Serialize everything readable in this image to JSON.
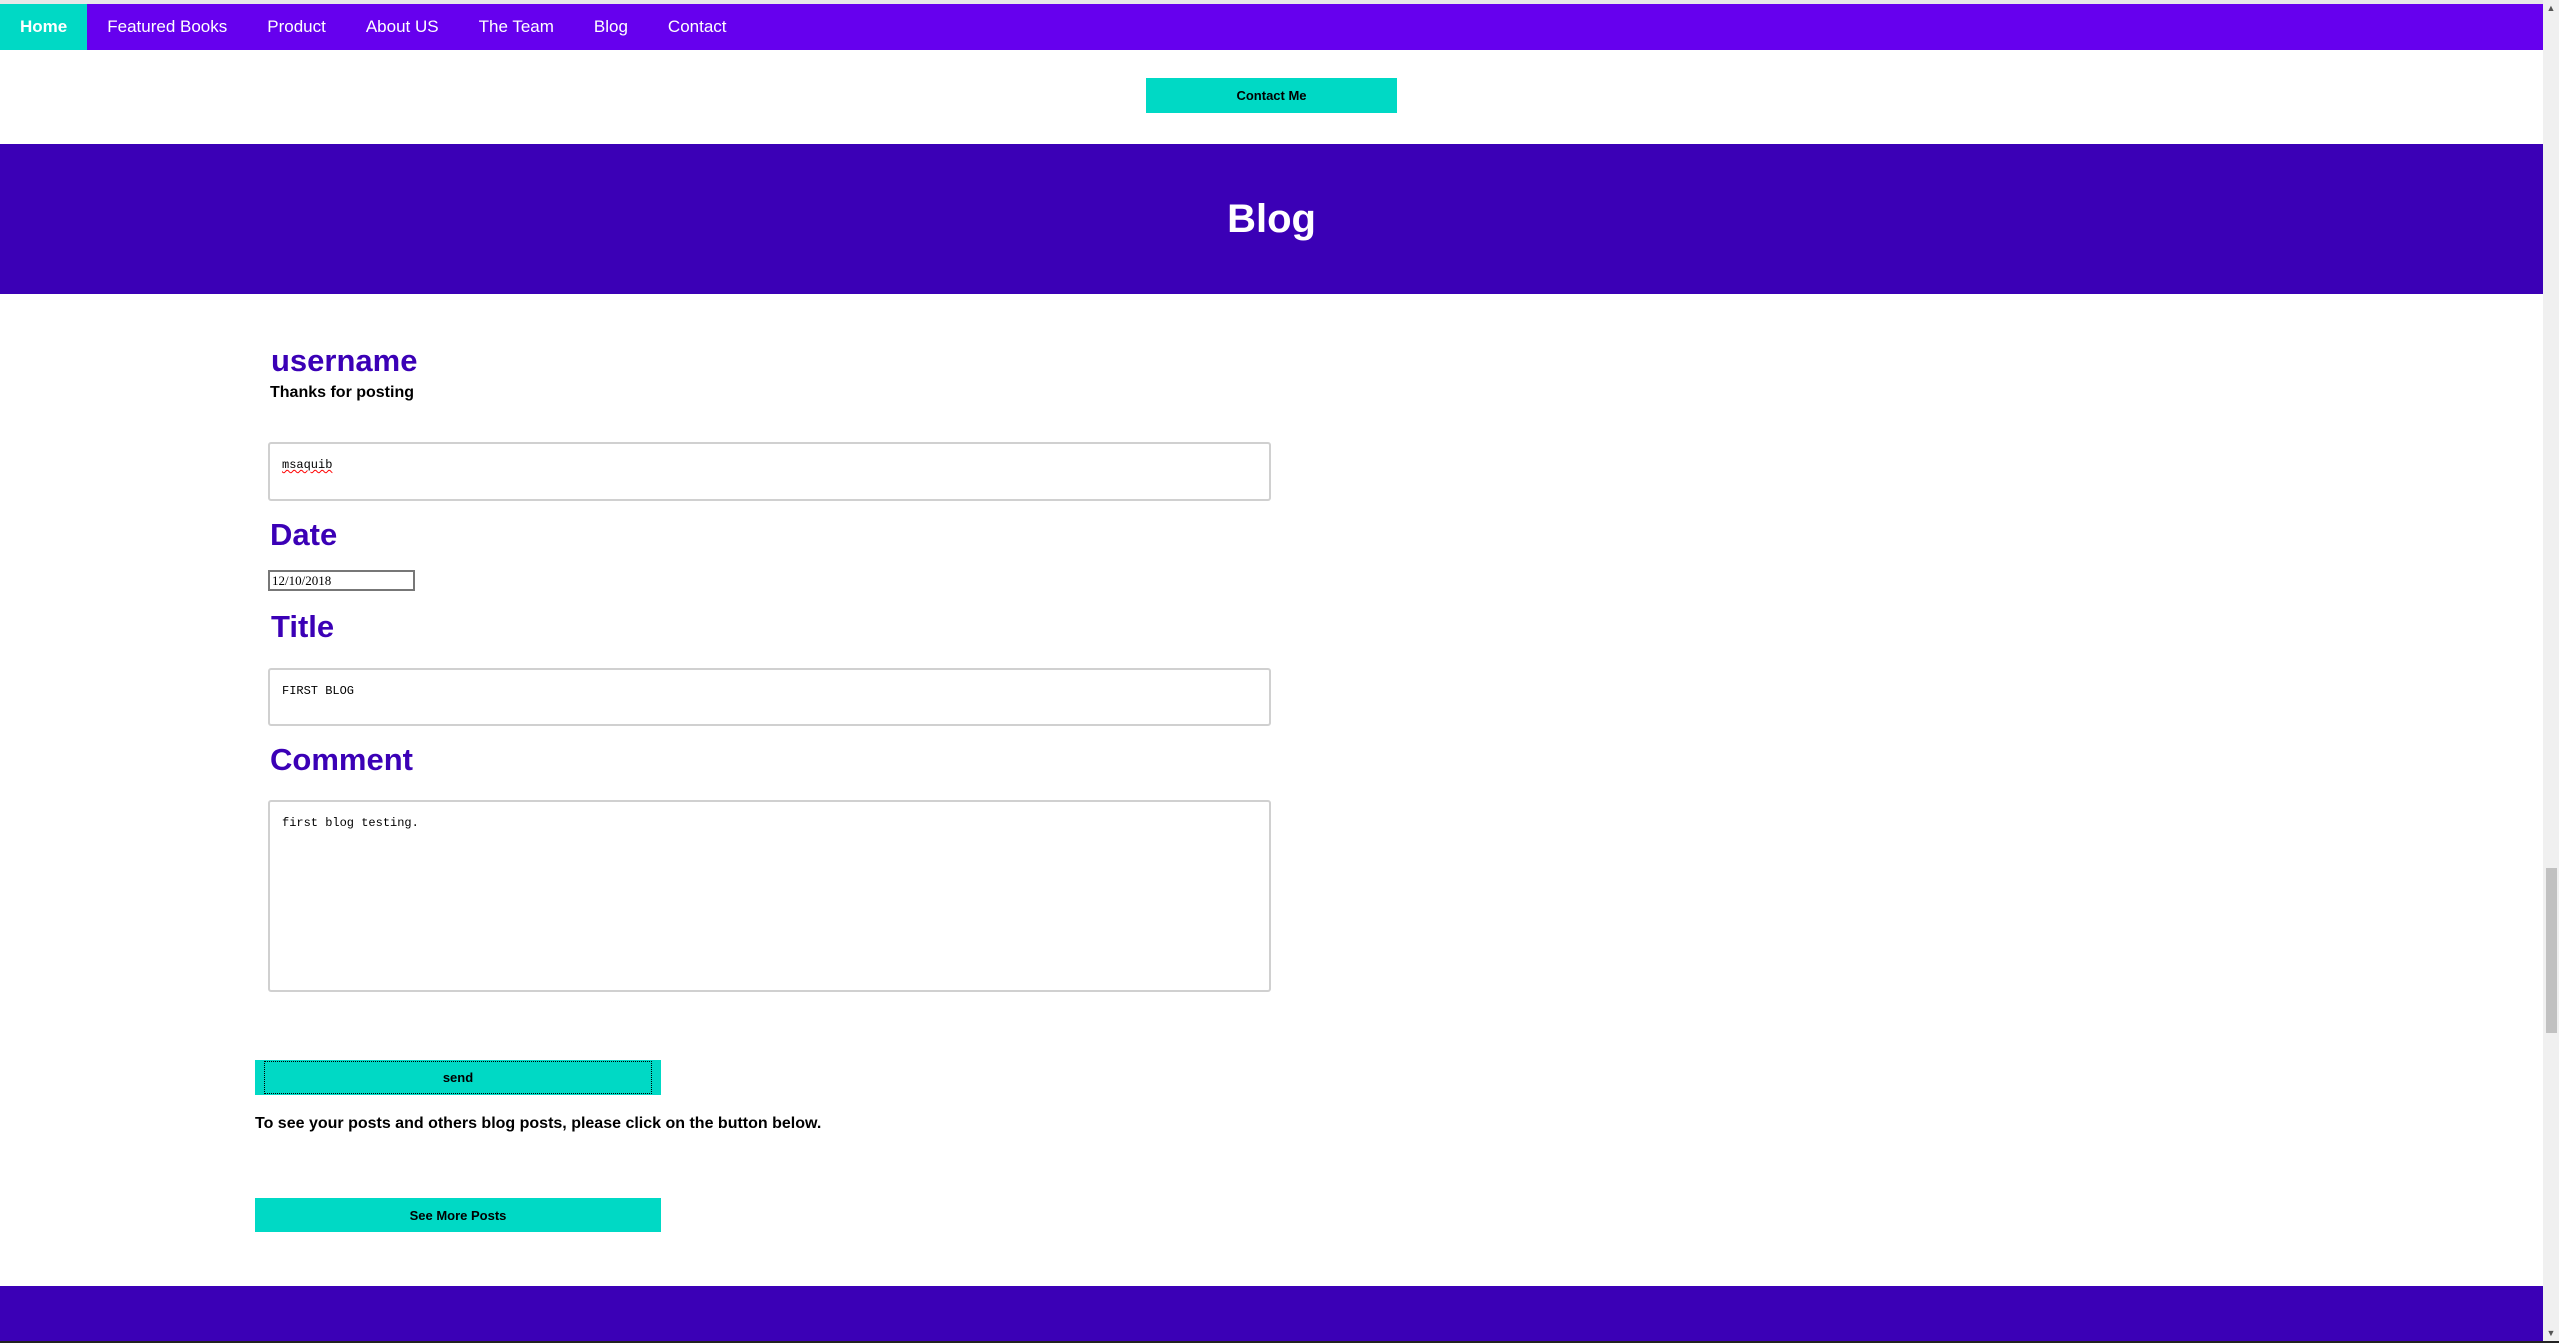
{
  "nav": {
    "items": [
      {
        "label": "Home",
        "active": true
      },
      {
        "label": "Featured Books"
      },
      {
        "label": "Product"
      },
      {
        "label": "About US"
      },
      {
        "label": "The Team"
      },
      {
        "label": "Blog"
      },
      {
        "label": "Contact"
      }
    ]
  },
  "contact_button": "Contact Me",
  "banner": {
    "title": "Blog"
  },
  "form": {
    "username_heading": "username",
    "thanks_text": "Thanks for posting",
    "username_value": "msaquib",
    "date_heading": "Date",
    "date_value": "12/10/2018",
    "title_heading": "Title",
    "title_value": "FIRST BLOG",
    "comment_heading": "Comment",
    "comment_value": "first blog testing.",
    "send_label": "send"
  },
  "info_text": "To see your posts and others blog posts, please click on the button below.",
  "more_posts_label": "See More Posts",
  "colors": {
    "nav": "#6600ee",
    "banner": "#3b00b6",
    "accent": "#00d9c5"
  }
}
